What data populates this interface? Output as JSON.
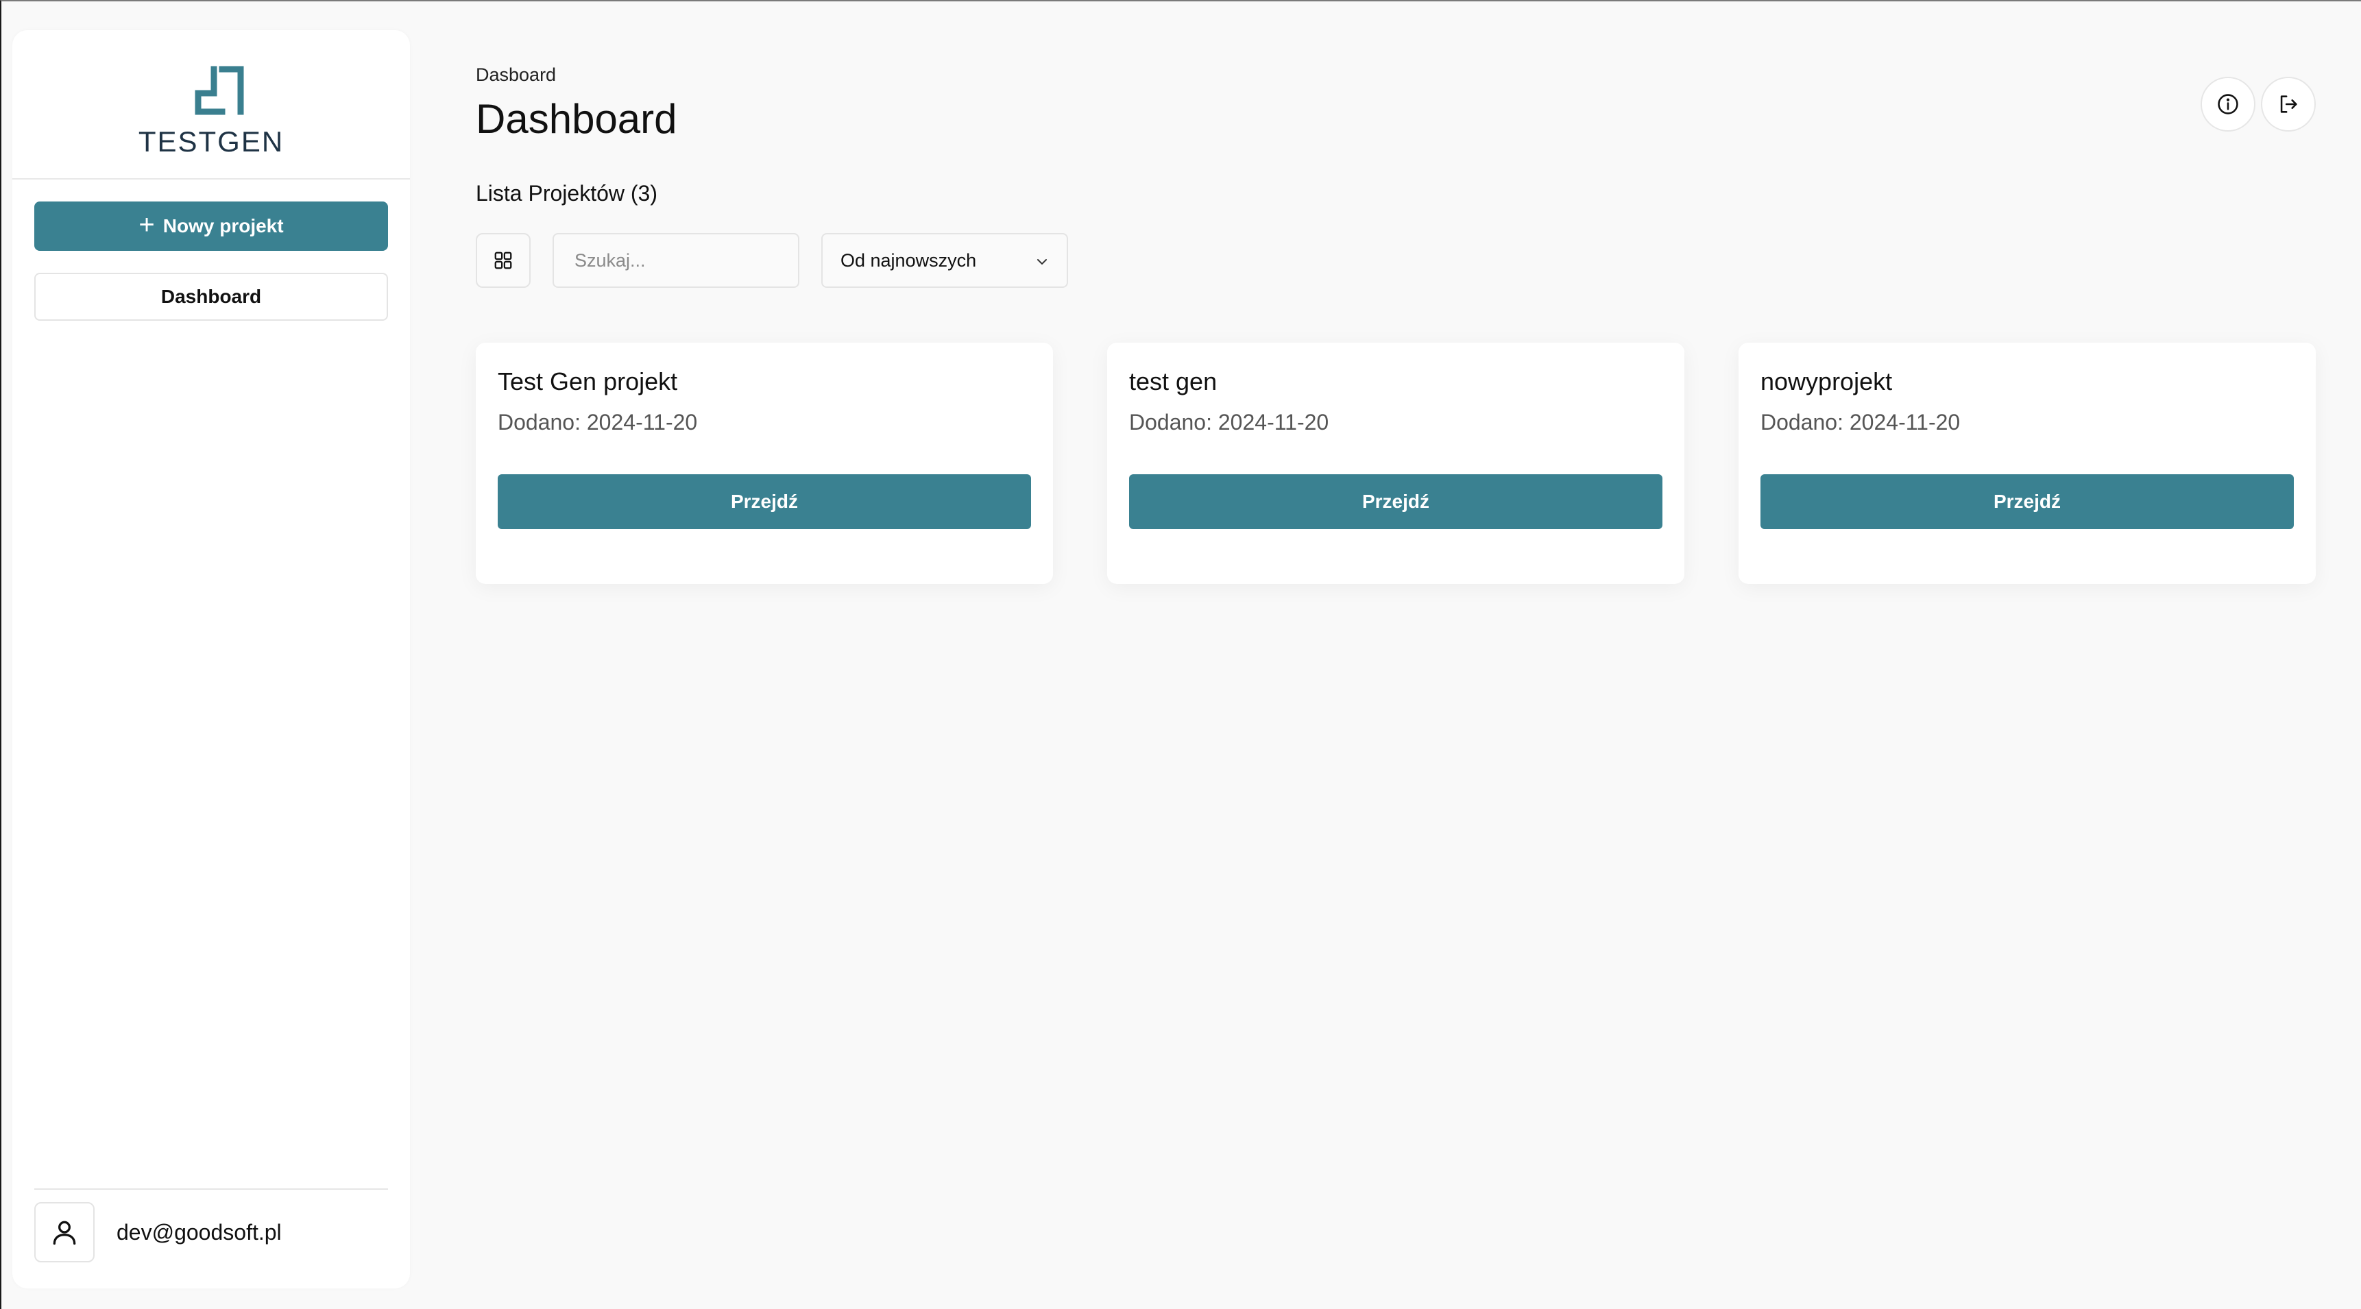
{
  "brand": {
    "name": "TESTGEN",
    "accent_color": "#3a8191",
    "logo_icon": "testgen-logo-mark"
  },
  "sidebar": {
    "new_project_label": "Nowy projekt",
    "new_project_icon": "plus-icon",
    "items": [
      {
        "label": "Dashboard"
      }
    ],
    "user": {
      "email": "dev@goodsoft.pl",
      "icon": "user-icon"
    }
  },
  "header": {
    "breadcrumb": "Dasboard",
    "title": "Dashboard",
    "actions": [
      {
        "icon": "info-icon"
      },
      {
        "icon": "logout-icon"
      }
    ]
  },
  "projects": {
    "list_title": "Lista Projektów (3)",
    "view_toggle_icon": "grid-icon",
    "search": {
      "placeholder": "Szukaj...",
      "value": ""
    },
    "sort": {
      "selected": "Od najnowszych"
    },
    "items": [
      {
        "name": "Test Gen projekt",
        "added": "Dodano: 2024-11-20",
        "action_label": "Przejdź"
      },
      {
        "name": "test gen",
        "added": "Dodano: 2024-11-20",
        "action_label": "Przejdź"
      },
      {
        "name": "nowyprojekt",
        "added": "Dodano: 2024-11-20",
        "action_label": "Przejdź"
      }
    ]
  }
}
